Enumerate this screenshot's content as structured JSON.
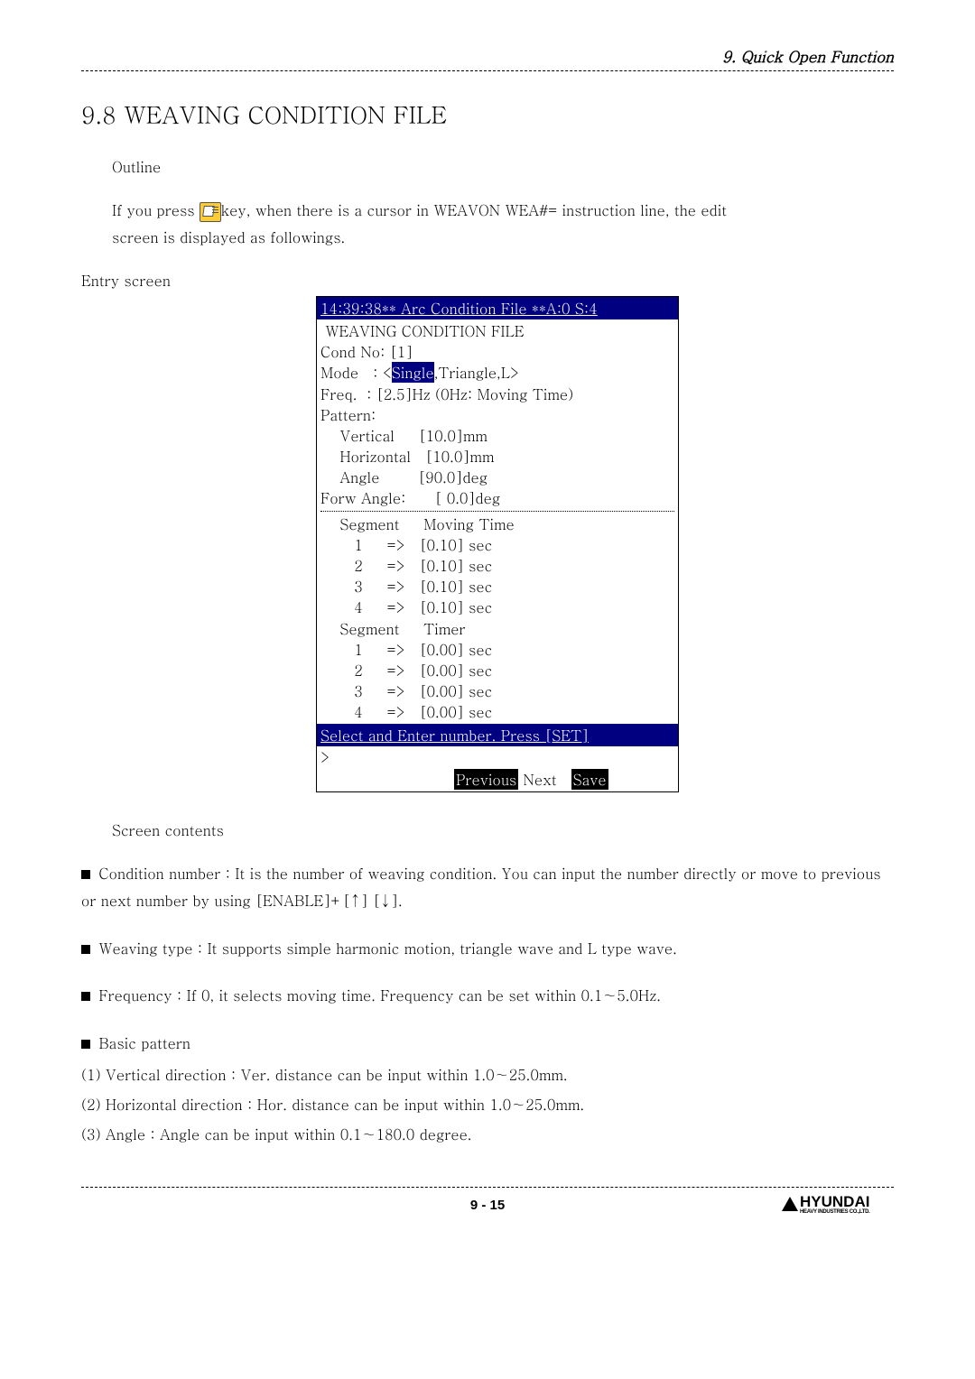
{
  "header": {
    "chapter": "9. Quick Open Function"
  },
  "section": {
    "title": "9.8 WEAVING CONDITION FILE",
    "outline_label": "Outline",
    "outline_text_a": "  If you press ",
    "outline_text_b": "key, when there is a cursor in WEAVON WEA#= instruction line, the edit",
    "outline_text_c": "screen is displayed as followings.",
    "entry_label": "Entry screen"
  },
  "terminal": {
    "titlebar": "14:39:38** Arc Condition File **A:0 S:4",
    "lines": {
      "l1": " WEAVING CONDITION FILE",
      "l2": "Cond No: [1]",
      "l3a": "Mode   : <",
      "l3_hi": "Single",
      "l3b": ",Triangle,L>",
      "l4": "Freq.  : [2.5]Hz (0Hz: Moving Time)",
      "l5": "Pattern:",
      "l6": "    Vertical     [10.0]mm",
      "l7": "    Horizontal   [10.0]mm",
      "l8": "    Angle        [90.0]deg",
      "l9": "Forw Angle:      [ 0.0]deg",
      "l10": "    Segment     Moving Time",
      "l11": "       1     =>   [0.10] sec",
      "l12": "       2     =>   [0.10] sec",
      "l13": "       3     =>   [0.10] sec",
      "l14": "       4     =>   [0.10] sec",
      "l15": "    Segment     Timer",
      "l16": "       1     =>   [0.00] sec",
      "l17": "       2     =>   [0.00] sec",
      "l18": "       3     =>   [0.00] sec",
      "l19": "       4     =>   [0.00] sec"
    },
    "footer": "Select and Enter number. Press [SET]  ",
    "prompt": ">",
    "buttons": {
      "prev": "Previous",
      "next": " Next ",
      "save": "Save"
    }
  },
  "contents": {
    "heading": "Screen contents",
    "items": [
      "Condition number : It is the number of weaving condition. You can input the number directly or move to previous or next number by using [ENABLE]+[↑] [↓].",
      "Weaving type : It supports simple harmonic motion, triangle wave and L type wave.",
      "Frequency : If 0, it selects moving time. Frequency can be set within 0.1∼5.0Hz.",
      "Basic pattern"
    ],
    "numbered": [
      "(1) Vertical direction : Ver. distance can be input within 1.0∼25.0mm.",
      "(2) Horizontal direction : Hor. distance can be input within 1.0∼25.0mm.",
      "(3) Angle : Angle can be input within 0.1∼180.0 degree."
    ]
  },
  "footer": {
    "page": "9 - 15",
    "logo_text": "HYUNDAI",
    "logo_sub": "HEAVY INDUSTRIES CO.,LTD."
  }
}
